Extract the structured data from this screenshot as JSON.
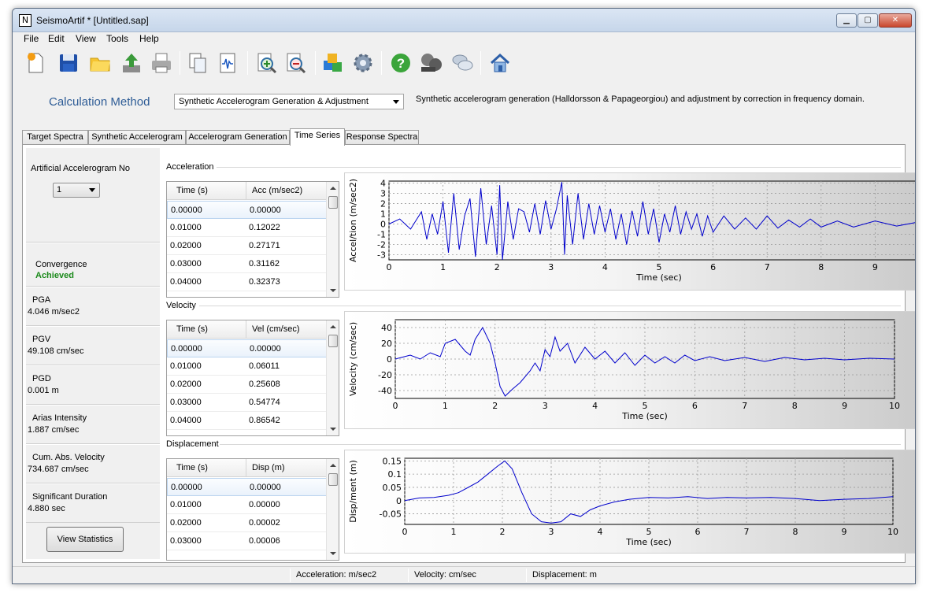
{
  "window": {
    "title": "SeismoArtif * [Untitled.sap]",
    "app_icon": "seismoartif-icon"
  },
  "menu": [
    "File",
    "Edit",
    "View",
    "Tools",
    "Help"
  ],
  "toolbar": {
    "buttons": [
      {
        "name": "new-file-icon"
      },
      {
        "name": "save-icon"
      },
      {
        "name": "open-folder-icon"
      },
      {
        "name": "export-icon"
      },
      {
        "name": "print-icon"
      },
      {
        "name": "copy-icon"
      },
      {
        "name": "report-icon"
      },
      {
        "name": "zoom-in-icon"
      },
      {
        "name": "zoom-out-icon"
      },
      {
        "name": "calculate-icon"
      },
      {
        "name": "settings-gear-icon"
      },
      {
        "name": "help-icon"
      },
      {
        "name": "video-tutorial-icon"
      },
      {
        "name": "chat-icon"
      },
      {
        "name": "home-icon"
      }
    ]
  },
  "method": {
    "label": "Calculation Method",
    "selected": "Synthetic Accelerogram Generation & Adjustment",
    "description": "Synthetic accelerogram generation (Halldorsson & Papageorgiou) and adjustment by correction in frequency domain."
  },
  "tabs": [
    "Target Spectra",
    "Synthetic Accelerogram",
    "Accelerogram Generation",
    "Time Series",
    "Response Spectra"
  ],
  "active_tab": "Time Series",
  "left": {
    "accno_label": "Artificial Accelerogram No",
    "accno_value": "1",
    "convergence_label": "Convergence",
    "convergence_value": "Achieved",
    "pga_label": "PGA",
    "pga_value": "4.046 m/sec2",
    "pgv_label": "PGV",
    "pgv_value": "49.108 cm/sec",
    "pgd_label": "PGD",
    "pgd_value": "0.001 m",
    "arias_label": "Arias Intensity",
    "arias_value": "1.887 cm/sec",
    "cav_label": "Cum. Abs. Velocity",
    "cav_value": "734.687 cm/sec",
    "sigdur_label": "Significant Duration",
    "sigdur_value": "4.880 sec",
    "stats_button": "View Statistics"
  },
  "sections": {
    "acceleration": {
      "title": "Acceleration",
      "col1": "Time (s)",
      "col2": "Acc (m/sec2)",
      "rows": [
        [
          "0.00000",
          "0.00000"
        ],
        [
          "0.01000",
          "0.12022"
        ],
        [
          "0.02000",
          "0.27171"
        ],
        [
          "0.03000",
          "0.31162"
        ],
        [
          "0.04000",
          "0.32373"
        ]
      ]
    },
    "velocity": {
      "title": "Velocity",
      "col1": "Time (s)",
      "col2": "Vel (cm/sec)",
      "rows": [
        [
          "0.00000",
          "0.00000"
        ],
        [
          "0.01000",
          "0.06011"
        ],
        [
          "0.02000",
          "0.25608"
        ],
        [
          "0.03000",
          "0.54774"
        ],
        [
          "0.04000",
          "0.86542"
        ]
      ]
    },
    "displacement": {
      "title": "Displacement",
      "col1": "Time (s)",
      "col2": "Disp (m)",
      "rows": [
        [
          "0.00000",
          "0.00000"
        ],
        [
          "0.01000",
          "0.00000"
        ],
        [
          "0.02000",
          "0.00002"
        ],
        [
          "0.03000",
          "0.00006"
        ]
      ]
    }
  },
  "chart_data": [
    {
      "type": "line",
      "xlabel": "Time (sec)",
      "ylabel": "Accel/tion (m/sec2)",
      "xlim": [
        0,
        10
      ],
      "ylim": [
        -3.5,
        4.2
      ],
      "xticks": [
        0,
        1,
        2,
        3,
        4,
        5,
        6,
        7,
        8,
        9,
        10
      ],
      "yticks": [
        4,
        3,
        2,
        1,
        0,
        -1,
        -2,
        -3
      ],
      "grid": true,
      "color": "#0000cc",
      "series": [
        {
          "x": [
            0,
            0.2,
            0.4,
            0.6,
            0.7,
            0.8,
            0.9,
            1.0,
            1.1,
            1.2,
            1.3,
            1.4,
            1.5,
            1.6,
            1.7,
            1.8,
            1.9,
            2.0,
            2.05,
            2.1,
            2.2,
            2.3,
            2.4,
            2.5,
            2.6,
            2.7,
            2.8,
            2.9,
            3.0,
            3.1,
            3.2,
            3.25,
            3.3,
            3.4,
            3.5,
            3.6,
            3.7,
            3.8,
            3.9,
            4.0,
            4.1,
            4.2,
            4.3,
            4.4,
            4.5,
            4.6,
            4.7,
            4.8,
            4.9,
            5.0,
            5.1,
            5.2,
            5.3,
            5.4,
            5.5,
            5.6,
            5.7,
            5.8,
            5.9,
            6.0,
            6.2,
            6.4,
            6.6,
            6.8,
            7.0,
            7.2,
            7.4,
            7.6,
            7.8,
            8.0,
            8.3,
            8.6,
            9.0,
            9.4,
            9.8,
            10.0
          ],
          "y": [
            0,
            0.5,
            -0.5,
            1.2,
            -1.5,
            1.0,
            -1.0,
            2.2,
            -2.8,
            3.0,
            -2.5,
            0.8,
            2.5,
            -3.2,
            3.5,
            -2.0,
            1.8,
            -3.0,
            3.8,
            -3.5,
            2.2,
            -1.5,
            1.5,
            1.2,
            -0.8,
            2.0,
            -1.0,
            2.3,
            -0.5,
            1.5,
            4.1,
            -3.0,
            2.8,
            -2.0,
            3.0,
            -1.5,
            2.0,
            -1.0,
            1.8,
            -0.8,
            1.5,
            -1.5,
            1.0,
            -2.0,
            1.3,
            -1.2,
            2.2,
            -1.0,
            1.5,
            -1.8,
            1.0,
            -0.8,
            1.8,
            -1.0,
            1.2,
            -0.5,
            1.0,
            -1.2,
            0.8,
            -0.8,
            0.8,
            -0.5,
            0.6,
            -0.5,
            0.8,
            -0.4,
            0.4,
            -0.3,
            0.5,
            -0.3,
            0.3,
            -0.3,
            0.3,
            -0.2,
            0.2,
            0.0
          ]
        }
      ]
    },
    {
      "type": "line",
      "xlabel": "Time (sec)",
      "ylabel": "Velocity (cm/sec)",
      "xlim": [
        0,
        10
      ],
      "ylim": [
        -50,
        50
      ],
      "xticks": [
        0,
        1,
        2,
        3,
        4,
        5,
        6,
        7,
        8,
        9,
        10
      ],
      "yticks": [
        40,
        20,
        0,
        -20,
        -40
      ],
      "grid": true,
      "color": "#0000cc",
      "series": [
        {
          "x": [
            0,
            0.3,
            0.5,
            0.7,
            0.9,
            1.0,
            1.2,
            1.4,
            1.5,
            1.6,
            1.75,
            1.9,
            2.0,
            2.1,
            2.2,
            2.35,
            2.5,
            2.7,
            2.8,
            2.9,
            3.0,
            3.1,
            3.2,
            3.3,
            3.45,
            3.6,
            3.8,
            4.0,
            4.2,
            4.4,
            4.6,
            4.8,
            5.0,
            5.2,
            5.4,
            5.6,
            5.8,
            6.0,
            6.3,
            6.6,
            7.0,
            7.4,
            7.8,
            8.2,
            8.6,
            9.0,
            9.5,
            10.0
          ],
          "y": [
            0,
            5,
            0,
            8,
            3,
            20,
            25,
            10,
            5,
            25,
            40,
            20,
            -5,
            -35,
            -47,
            -38,
            -30,
            -15,
            -5,
            -15,
            12,
            3,
            28,
            10,
            20,
            -5,
            15,
            0,
            10,
            -5,
            8,
            -8,
            5,
            -5,
            3,
            -5,
            5,
            -2,
            3,
            -2,
            2,
            -3,
            2,
            -1,
            1,
            -1,
            1,
            0
          ]
        }
      ]
    },
    {
      "type": "line",
      "xlabel": "Time (sec)",
      "ylabel": "Disp/ment (m)",
      "xlim": [
        0,
        10
      ],
      "ylim": [
        -0.09,
        0.16
      ],
      "xticks": [
        0,
        1,
        2,
        3,
        4,
        5,
        6,
        7,
        8,
        9,
        10
      ],
      "yticks": [
        0.15,
        0.1,
        0.05,
        0,
        -0.05
      ],
      "grid": true,
      "color": "#0000cc",
      "series": [
        {
          "x": [
            0,
            0.3,
            0.6,
            0.9,
            1.1,
            1.3,
            1.5,
            1.7,
            1.9,
            2.05,
            2.2,
            2.4,
            2.6,
            2.8,
            3.0,
            3.2,
            3.4,
            3.6,
            3.8,
            4.0,
            4.3,
            4.6,
            5.0,
            5.4,
            5.8,
            6.2,
            6.6,
            7.0,
            7.5,
            8.0,
            8.5,
            9.0,
            9.5,
            10.0
          ],
          "y": [
            0,
            0.01,
            0.012,
            0.02,
            0.03,
            0.05,
            0.07,
            0.1,
            0.13,
            0.15,
            0.12,
            0.03,
            -0.05,
            -0.08,
            -0.085,
            -0.08,
            -0.05,
            -0.06,
            -0.035,
            -0.02,
            -0.005,
            0.005,
            0.012,
            0.01,
            0.015,
            0.008,
            0.012,
            0.01,
            0.012,
            0.008,
            0.0,
            0.005,
            0.008,
            0.015
          ]
        }
      ]
    }
  ],
  "status": {
    "acc_unit": "Acceleration: m/sec2",
    "vel_unit": "Velocity: cm/sec",
    "disp_unit": "Displacement: m"
  }
}
